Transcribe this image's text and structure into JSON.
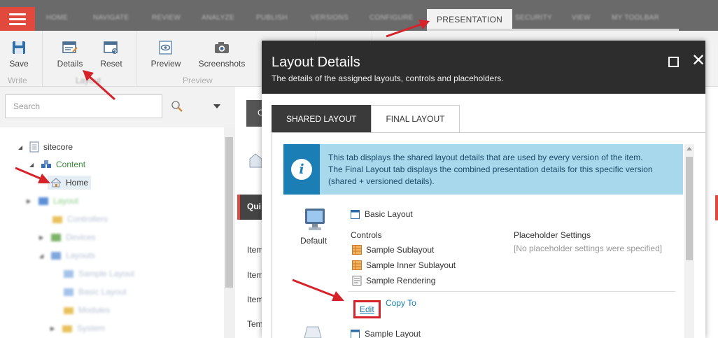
{
  "ribbon_tabs": [
    {
      "label": "HOME",
      "active": false
    },
    {
      "label": "NAVIGATE",
      "active": false
    },
    {
      "label": "REVIEW",
      "active": false
    },
    {
      "label": "ANALYZE",
      "active": false
    },
    {
      "label": "PUBLISH",
      "active": false
    },
    {
      "label": "VERSIONS",
      "active": false
    },
    {
      "label": "CONFIGURE",
      "active": false
    },
    {
      "label": "PRESENTATION",
      "active": true
    },
    {
      "label": "SECURITY",
      "active": false
    },
    {
      "label": "VIEW",
      "active": false
    },
    {
      "label": "MY TOOLBAR",
      "active": false
    }
  ],
  "ribbon": {
    "save": "Save",
    "write_group": "Write",
    "details": "Details",
    "reset": "Reset",
    "layout_group": "Layout",
    "preview": "Preview",
    "screenshots": "Screenshots",
    "preview_group": "Preview"
  },
  "search": {
    "placeholder": "Search"
  },
  "tree": [
    {
      "label": "sitecore",
      "icon": "page-icon"
    },
    {
      "label": "Content",
      "icon": "content-icon"
    },
    {
      "label": "Home",
      "icon": "home-icon",
      "selected": true
    },
    {
      "label": "Layout",
      "icon": "layout-folder-icon"
    },
    {
      "label": "Controllers",
      "icon": "folder-icon"
    },
    {
      "label": "Devices",
      "icon": "devices-icon"
    },
    {
      "label": "Layouts",
      "icon": "layouts-icon"
    },
    {
      "label": "Sample Layout",
      "icon": "layout-icon"
    },
    {
      "label": "Basic Layout",
      "icon": "layout-icon"
    },
    {
      "label": "Modules",
      "icon": "folder-icon"
    },
    {
      "label": "System",
      "icon": "folder-icon"
    }
  ],
  "middle": {
    "tab": "C",
    "header": "Qui",
    "labels": [
      "Item",
      "Item",
      "Item",
      "Tem"
    ]
  },
  "dialog": {
    "title": "Layout Details",
    "subtitle": "The details of the assigned layouts, controls and placeholders.",
    "tabs": {
      "shared": "SHARED LAYOUT",
      "final": "FINAL LAYOUT"
    },
    "info_line1": "This tab displays the shared layout details that are used by every version of the item.",
    "info_line2": "The Final Layout tab displays the combined presentation details for this specific version",
    "info_line3": "(shared + versioned details).",
    "device": "Default",
    "layout": "Basic Layout",
    "controls_heading": "Controls",
    "placeholder_heading": "Placeholder Settings",
    "placeholder_empty": "[No placeholder settings were specified]",
    "controls": [
      "Sample Sublayout",
      "Sample Inner Sublayout",
      "Sample Rendering"
    ],
    "edit": "Edit",
    "copy_to": "Copy To",
    "layout2": "Sample Layout"
  },
  "colors": {
    "accent": "#e0493b",
    "dark": "#2d2d2d",
    "info_bg": "#a8d8ec",
    "info_icon": "#1b7fb5",
    "link": "#1b7fb5",
    "annotation": "#d6232a"
  }
}
